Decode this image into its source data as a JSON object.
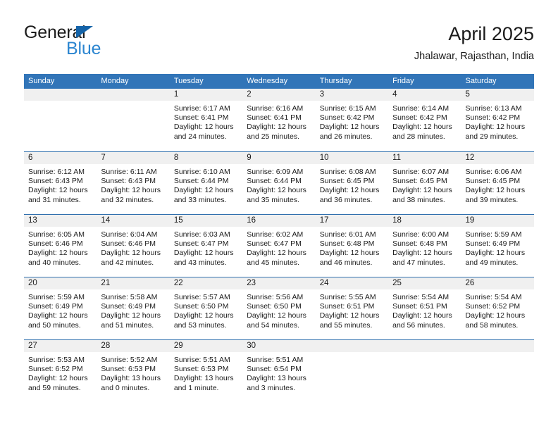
{
  "brand": {
    "line1": "General",
    "line2": "Blue",
    "triangle_color": "#1463a8",
    "blue_color": "#2b85d0"
  },
  "header": {
    "title": "April 2025",
    "subtitle": "Jhalawar, Rajasthan, India"
  },
  "theme": {
    "header_blue": "#3275b8",
    "row_rule_blue": "#2f6fae",
    "day_strip_gray": "#f0f0f0"
  },
  "weekdays": [
    "Sunday",
    "Monday",
    "Tuesday",
    "Wednesday",
    "Thursday",
    "Friday",
    "Saturday"
  ],
  "weeks": [
    [
      {
        "day": "",
        "lines": []
      },
      {
        "day": "",
        "lines": []
      },
      {
        "day": "1",
        "lines": [
          "Sunrise: 6:17 AM",
          "Sunset: 6:41 PM",
          "Daylight: 12 hours",
          "and 24 minutes."
        ]
      },
      {
        "day": "2",
        "lines": [
          "Sunrise: 6:16 AM",
          "Sunset: 6:41 PM",
          "Daylight: 12 hours",
          "and 25 minutes."
        ]
      },
      {
        "day": "3",
        "lines": [
          "Sunrise: 6:15 AM",
          "Sunset: 6:42 PM",
          "Daylight: 12 hours",
          "and 26 minutes."
        ]
      },
      {
        "day": "4",
        "lines": [
          "Sunrise: 6:14 AM",
          "Sunset: 6:42 PM",
          "Daylight: 12 hours",
          "and 28 minutes."
        ]
      },
      {
        "day": "5",
        "lines": [
          "Sunrise: 6:13 AM",
          "Sunset: 6:42 PM",
          "Daylight: 12 hours",
          "and 29 minutes."
        ]
      }
    ],
    [
      {
        "day": "6",
        "lines": [
          "Sunrise: 6:12 AM",
          "Sunset: 6:43 PM",
          "Daylight: 12 hours",
          "and 31 minutes."
        ]
      },
      {
        "day": "7",
        "lines": [
          "Sunrise: 6:11 AM",
          "Sunset: 6:43 PM",
          "Daylight: 12 hours",
          "and 32 minutes."
        ]
      },
      {
        "day": "8",
        "lines": [
          "Sunrise: 6:10 AM",
          "Sunset: 6:44 PM",
          "Daylight: 12 hours",
          "and 33 minutes."
        ]
      },
      {
        "day": "9",
        "lines": [
          "Sunrise: 6:09 AM",
          "Sunset: 6:44 PM",
          "Daylight: 12 hours",
          "and 35 minutes."
        ]
      },
      {
        "day": "10",
        "lines": [
          "Sunrise: 6:08 AM",
          "Sunset: 6:45 PM",
          "Daylight: 12 hours",
          "and 36 minutes."
        ]
      },
      {
        "day": "11",
        "lines": [
          "Sunrise: 6:07 AM",
          "Sunset: 6:45 PM",
          "Daylight: 12 hours",
          "and 38 minutes."
        ]
      },
      {
        "day": "12",
        "lines": [
          "Sunrise: 6:06 AM",
          "Sunset: 6:45 PM",
          "Daylight: 12 hours",
          "and 39 minutes."
        ]
      }
    ],
    [
      {
        "day": "13",
        "lines": [
          "Sunrise: 6:05 AM",
          "Sunset: 6:46 PM",
          "Daylight: 12 hours",
          "and 40 minutes."
        ]
      },
      {
        "day": "14",
        "lines": [
          "Sunrise: 6:04 AM",
          "Sunset: 6:46 PM",
          "Daylight: 12 hours",
          "and 42 minutes."
        ]
      },
      {
        "day": "15",
        "lines": [
          "Sunrise: 6:03 AM",
          "Sunset: 6:47 PM",
          "Daylight: 12 hours",
          "and 43 minutes."
        ]
      },
      {
        "day": "16",
        "lines": [
          "Sunrise: 6:02 AM",
          "Sunset: 6:47 PM",
          "Daylight: 12 hours",
          "and 45 minutes."
        ]
      },
      {
        "day": "17",
        "lines": [
          "Sunrise: 6:01 AM",
          "Sunset: 6:48 PM",
          "Daylight: 12 hours",
          "and 46 minutes."
        ]
      },
      {
        "day": "18",
        "lines": [
          "Sunrise: 6:00 AM",
          "Sunset: 6:48 PM",
          "Daylight: 12 hours",
          "and 47 minutes."
        ]
      },
      {
        "day": "19",
        "lines": [
          "Sunrise: 5:59 AM",
          "Sunset: 6:49 PM",
          "Daylight: 12 hours",
          "and 49 minutes."
        ]
      }
    ],
    [
      {
        "day": "20",
        "lines": [
          "Sunrise: 5:59 AM",
          "Sunset: 6:49 PM",
          "Daylight: 12 hours",
          "and 50 minutes."
        ]
      },
      {
        "day": "21",
        "lines": [
          "Sunrise: 5:58 AM",
          "Sunset: 6:49 PM",
          "Daylight: 12 hours",
          "and 51 minutes."
        ]
      },
      {
        "day": "22",
        "lines": [
          "Sunrise: 5:57 AM",
          "Sunset: 6:50 PM",
          "Daylight: 12 hours",
          "and 53 minutes."
        ]
      },
      {
        "day": "23",
        "lines": [
          "Sunrise: 5:56 AM",
          "Sunset: 6:50 PM",
          "Daylight: 12 hours",
          "and 54 minutes."
        ]
      },
      {
        "day": "24",
        "lines": [
          "Sunrise: 5:55 AM",
          "Sunset: 6:51 PM",
          "Daylight: 12 hours",
          "and 55 minutes."
        ]
      },
      {
        "day": "25",
        "lines": [
          "Sunrise: 5:54 AM",
          "Sunset: 6:51 PM",
          "Daylight: 12 hours",
          "and 56 minutes."
        ]
      },
      {
        "day": "26",
        "lines": [
          "Sunrise: 5:54 AM",
          "Sunset: 6:52 PM",
          "Daylight: 12 hours",
          "and 58 minutes."
        ]
      }
    ],
    [
      {
        "day": "27",
        "lines": [
          "Sunrise: 5:53 AM",
          "Sunset: 6:52 PM",
          "Daylight: 12 hours",
          "and 59 minutes."
        ]
      },
      {
        "day": "28",
        "lines": [
          "Sunrise: 5:52 AM",
          "Sunset: 6:53 PM",
          "Daylight: 13 hours",
          "and 0 minutes."
        ]
      },
      {
        "day": "29",
        "lines": [
          "Sunrise: 5:51 AM",
          "Sunset: 6:53 PM",
          "Daylight: 13 hours",
          "and 1 minute."
        ]
      },
      {
        "day": "30",
        "lines": [
          "Sunrise: 5:51 AM",
          "Sunset: 6:54 PM",
          "Daylight: 13 hours",
          "and 3 minutes."
        ]
      },
      {
        "day": "",
        "lines": []
      },
      {
        "day": "",
        "lines": []
      },
      {
        "day": "",
        "lines": []
      }
    ]
  ]
}
